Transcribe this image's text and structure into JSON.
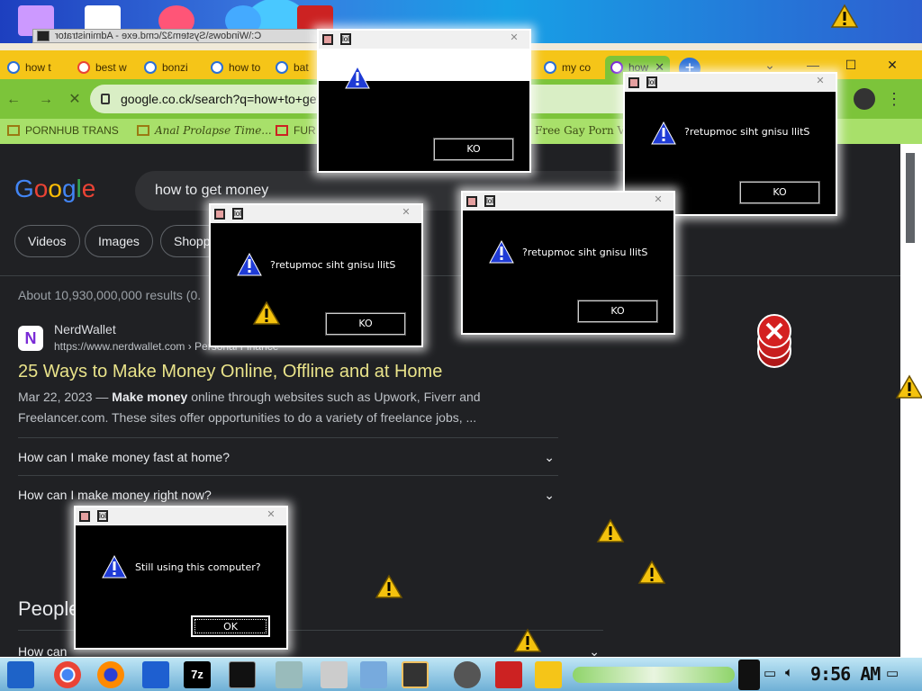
{
  "console": {
    "title": "C:\\Windows\\System32\\cmd.exe - Administrator"
  },
  "browser": {
    "tabs": [
      {
        "label": "how t"
      },
      {
        "label": "best w"
      },
      {
        "label": "bonzi"
      },
      {
        "label": "how to"
      },
      {
        "label": "bat"
      },
      {
        "label": "my co"
      },
      {
        "label": "how"
      }
    ],
    "url": "google.co.ck/search?q=how+to+get+money",
    "bookmarks": [
      {
        "label": "PORNHUB TRANS"
      },
      {
        "label": "Anal Prolapse Time..."
      },
      {
        "label": "FUR"
      },
      {
        "label": "Free Gay Porn Vid"
      }
    ]
  },
  "google": {
    "logo": [
      "G",
      "o",
      "o",
      "g",
      "l",
      "e"
    ],
    "query": "how to get money",
    "chips": [
      "Videos",
      "Images",
      "Shopp"
    ],
    "stats": "About 10,930,000,000 results (0.",
    "result": {
      "logo_letter": "N",
      "site": "NerdWallet",
      "url": "https://www.nerdwallet.com › Personal Finance",
      "title": "25 Ways to Make Money Online, Offline and at Home",
      "date": "Mar 22, 2023 — ",
      "bold": "Make money",
      "desc": " online through websites such as Upwork, Fiverr and Freelancer.com. These sites offer opportunities to do a variety of freelance jobs, ..."
    },
    "faqs": [
      "How can I make money fast at home?",
      "How can I make money right now?"
    ],
    "paa_title": "People",
    "paa": [
      "How can",
      "How can I make money right now?"
    ]
  },
  "dialogs": {
    "reversed_msg": "?retupmoc siht gnisu llitS",
    "reversed_ok": "KO",
    "normal_msg": "Still using this computer?",
    "normal_ok": "OK",
    "tb_glyph": "lol"
  },
  "taskbar": {
    "clock": "9:56 AM"
  },
  "colors": {
    "tabstrip": "#f5c518",
    "toolbar": "#7cc43a",
    "bookmarks": "#a8e06a",
    "result_title": "#e9e38a"
  }
}
